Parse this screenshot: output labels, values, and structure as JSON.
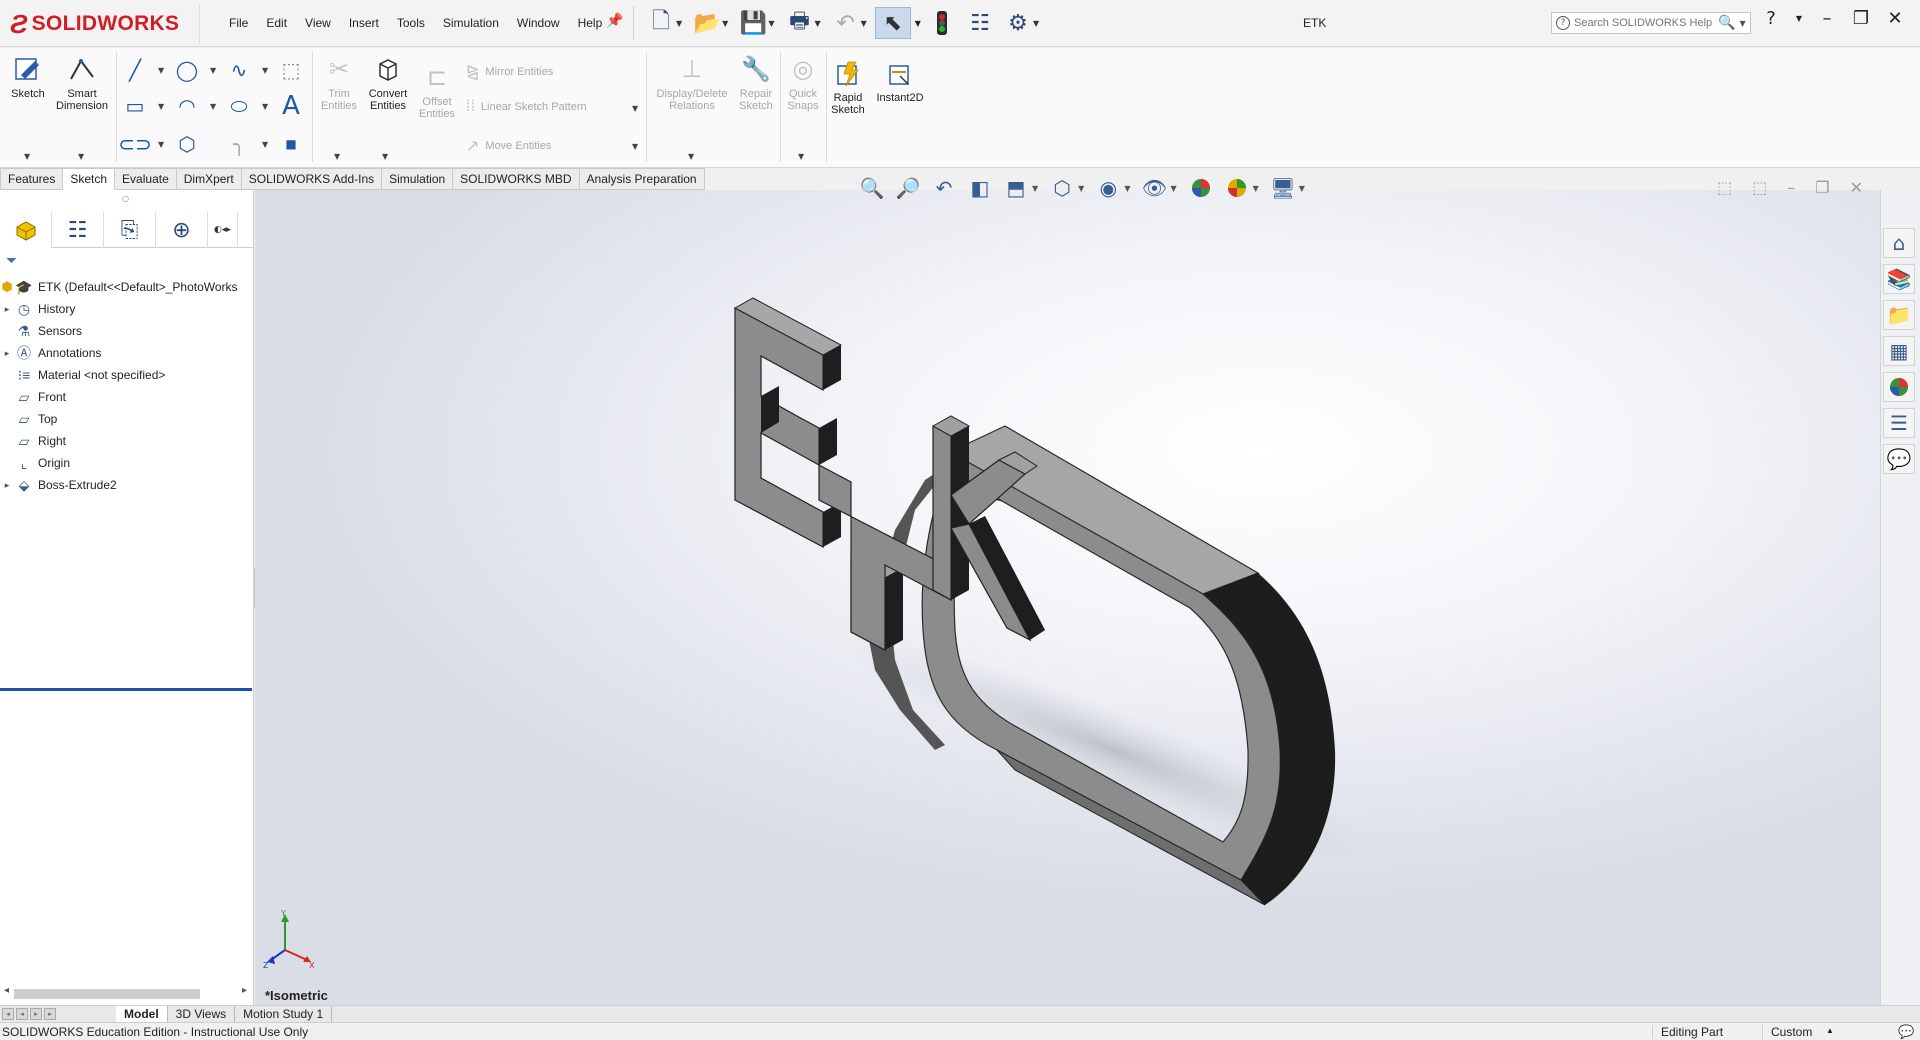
{
  "app": {
    "logo_text": "SOLIDWORKS",
    "document_title": "ETK"
  },
  "menu": [
    "File",
    "Edit",
    "View",
    "Insert",
    "Tools",
    "Simulation",
    "Window",
    "Help"
  ],
  "search": {
    "placeholder": "Search SOLIDWORKS Help"
  },
  "command_manager": {
    "sketch": "Sketch",
    "smart_dimension_1": "Smart",
    "smart_dimension_2": "Dimension",
    "trim_1": "Trim",
    "trim_2": "Entities",
    "convert_1": "Convert",
    "convert_2": "Entities",
    "offset_1": "Offset",
    "offset_2": "Entities",
    "mirror": "Mirror Entities",
    "linear_pattern": "Linear Sketch Pattern",
    "move": "Move Entities",
    "display_delete_1": "Display/Delete",
    "display_delete_2": "Relations",
    "repair_1": "Repair",
    "repair_2": "Sketch",
    "quick_snaps_1": "Quick",
    "quick_snaps_2": "Snaps",
    "rapid_1": "Rapid",
    "rapid_2": "Sketch",
    "instant2d": "Instant2D"
  },
  "tabs": [
    "Features",
    "Sketch",
    "Evaluate",
    "DimXpert",
    "SOLIDWORKS Add-Ins",
    "Simulation",
    "SOLIDWORKS MBD",
    "Analysis Preparation"
  ],
  "active_tab": "Sketch",
  "feature_tree": {
    "root": "ETK  (Default<<Default>_PhotoWorks",
    "items": [
      {
        "label": "History",
        "expandable": true,
        "icon": "history-icon"
      },
      {
        "label": "Sensors",
        "expandable": false,
        "icon": "sensors-icon"
      },
      {
        "label": "Annotations",
        "expandable": true,
        "icon": "annotations-icon"
      },
      {
        "label": "Material <not specified>",
        "expandable": false,
        "icon": "material-icon"
      },
      {
        "label": "Front",
        "expandable": false,
        "icon": "plane-icon"
      },
      {
        "label": "Top",
        "expandable": false,
        "icon": "plane-icon"
      },
      {
        "label": "Right",
        "expandable": false,
        "icon": "plane-icon"
      },
      {
        "label": "Origin",
        "expandable": false,
        "icon": "origin-icon"
      },
      {
        "label": "Boss-Extrude2",
        "expandable": true,
        "icon": "extrude-icon"
      }
    ]
  },
  "viewport": {
    "view_name": "*Isometric",
    "model_color": "#8c8c8c"
  },
  "bottom_tabs": [
    "Model",
    "3D Views",
    "Motion Study 1"
  ],
  "active_bottom_tab": "Model",
  "status": {
    "message": "SOLIDWORKS Education Edition - Instructional Use Only",
    "editing": "Editing Part",
    "units": "Custom"
  },
  "colors": {
    "brand": "#d21d24",
    "rollback_bar": "#1f4fb4"
  }
}
